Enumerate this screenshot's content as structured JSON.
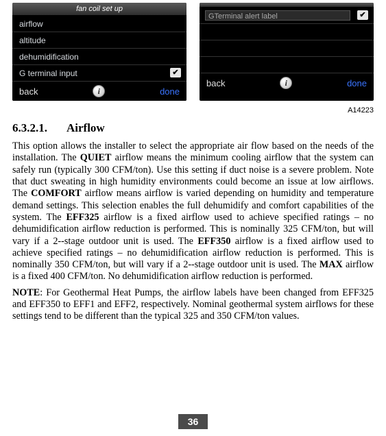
{
  "screenLeft": {
    "title": "fan coil set up",
    "rows": [
      "airflow",
      "altitude",
      "dehumidification",
      "G terminal input"
    ],
    "checkedRowIndex": 3,
    "back": "back",
    "done": "done",
    "info": "i"
  },
  "screenRight": {
    "title": " ",
    "inputLabel": "GTerminal  alert label",
    "checkedInput": true,
    "back": "back",
    "done": "done",
    "info": "i"
  },
  "figureLabel": "A14223",
  "heading": {
    "num": "6.3.2.1.",
    "title": "Airflow"
  },
  "para1": {
    "t1": "This option allows the installer to select the appropriate air flow based on the needs of the installation. The ",
    "b1": "QUIET",
    "t2": " airflow means the minimum cooling airflow that the system can safely run (typically 300 CFM/ton). Use this setting if duct noise is a severe problem. Note that duct sweating in high humidity environments could become an issue at low airflows. The ",
    "b2": "COMFORT",
    "t3": " airflow means airflow is varied depending on humidity and temperature demand settings. This selection enables the full dehumidify and comfort capabilities of the system. The ",
    "b3": "EFF325",
    "t4": " airflow is a fixed airflow used to achieve specified ratings – no dehumidification airflow reduction is performed. This is nominally 325 CFM/ton, but will vary if a 2--stage outdoor unit is used. The ",
    "b4": "EFF350",
    "t5": " airflow is a fixed airflow used to achieve specified ratings – no dehumidification airflow reduction is performed. This is nominally 350 CFM/ton, but will vary if a 2--stage outdoor unit is used. The ",
    "b5": "MAX",
    "t6": " airflow is a fixed 400 CFM/ton. No dehumidification airflow reduction is performed."
  },
  "para2": {
    "b1": "NOTE",
    "t1": ":   For Geothermal Heat Pumps, the airflow labels have been changed from EFF325 and EFF350 to EFF1 and EFF2, respectively. Nominal geothermal system airflows for these settings tend to be different than the typical 325 and 350 CFM/ton values."
  },
  "pageNumber": "36"
}
